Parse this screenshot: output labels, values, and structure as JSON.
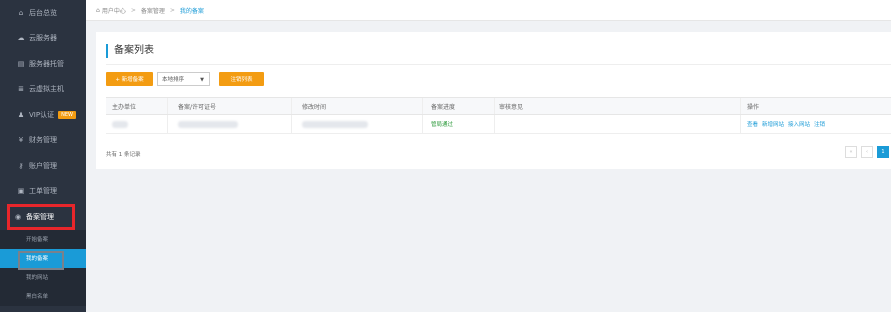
{
  "sidebar": {
    "items": [
      {
        "icon": "home-icon",
        "glyph": "⌂",
        "label": "后台总览"
      },
      {
        "icon": "cloud-icon",
        "glyph": "☁",
        "label": "云服务器"
      },
      {
        "icon": "server-icon",
        "glyph": "▤",
        "label": "服务器托管"
      },
      {
        "icon": "virtual-host-icon",
        "glyph": "≣",
        "label": "云虚拟主机"
      },
      {
        "icon": "user-icon",
        "glyph": "♟",
        "label": "VIP认证",
        "badge": "NEW"
      },
      {
        "icon": "yen-icon",
        "glyph": "¥",
        "label": "财务管理"
      },
      {
        "icon": "key-icon",
        "glyph": "⚷",
        "label": "账户管理"
      },
      {
        "icon": "ticket-icon",
        "glyph": "▣",
        "label": "工单管理"
      },
      {
        "icon": "record-icon",
        "glyph": "◉",
        "label": "备案管理"
      }
    ],
    "submenu": [
      {
        "label": "开始备案"
      },
      {
        "label": "我的备案"
      },
      {
        "label": "我的网站"
      },
      {
        "label": "黑白名单"
      }
    ]
  },
  "breadcrumb": {
    "home_glyph": "⌂",
    "items": [
      "用户中心",
      "备案管理",
      "我的备案"
    ],
    "separator": ">"
  },
  "panel": {
    "title": "备案列表",
    "add_button": "+ 新增备案",
    "sort_select": "本地排序",
    "cancel_list_button": "注销列表",
    "columns": [
      "主办单位",
      "备案/许可证号",
      "修改时间",
      "备案进度",
      "审核意见",
      "操作"
    ],
    "rows": [
      {
        "status": "管局通过",
        "actions": [
          "查看",
          "新增网站",
          "接入网站",
          "注销"
        ]
      }
    ],
    "total_text": "共有 1 条记录",
    "pager": {
      "prev": "‹",
      "first": "«",
      "current": "1"
    }
  },
  "colors": {
    "accent": "#1a9bd7",
    "orange": "#f39c12",
    "highlight": "#e8262b",
    "sidebar": "#2b3340"
  }
}
